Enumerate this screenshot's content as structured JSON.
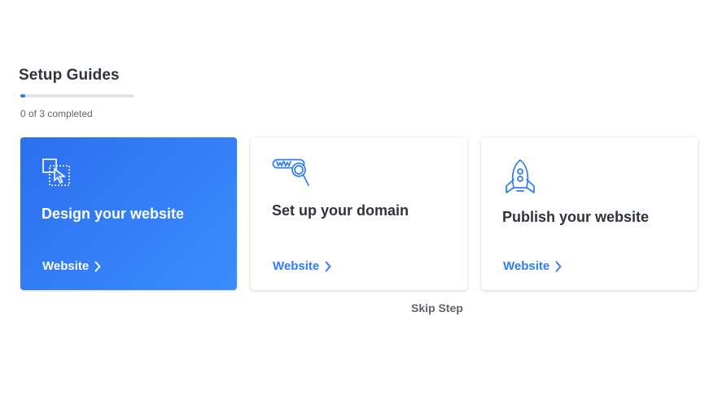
{
  "setup": {
    "title": "Setup Guides",
    "progress_text": "0 of 3 completed",
    "progress_fraction": 0.04
  },
  "cards": [
    {
      "title": "Design your website",
      "link": "Website",
      "icon": "design-selection-icon",
      "active": true
    },
    {
      "title": "Set up your domain",
      "link": "Website",
      "icon": "domain-search-icon",
      "active": false
    },
    {
      "title": "Publish your website",
      "link": "Website",
      "icon": "rocket-icon",
      "active": false
    }
  ],
  "skip_label": "Skip Step",
  "colors": {
    "accent": "#2f7cf6",
    "active_card_start": "#2c6ff0",
    "active_card_end": "#3b8cff",
    "text_dark": "#2f343b",
    "text_muted": "#62666d"
  }
}
